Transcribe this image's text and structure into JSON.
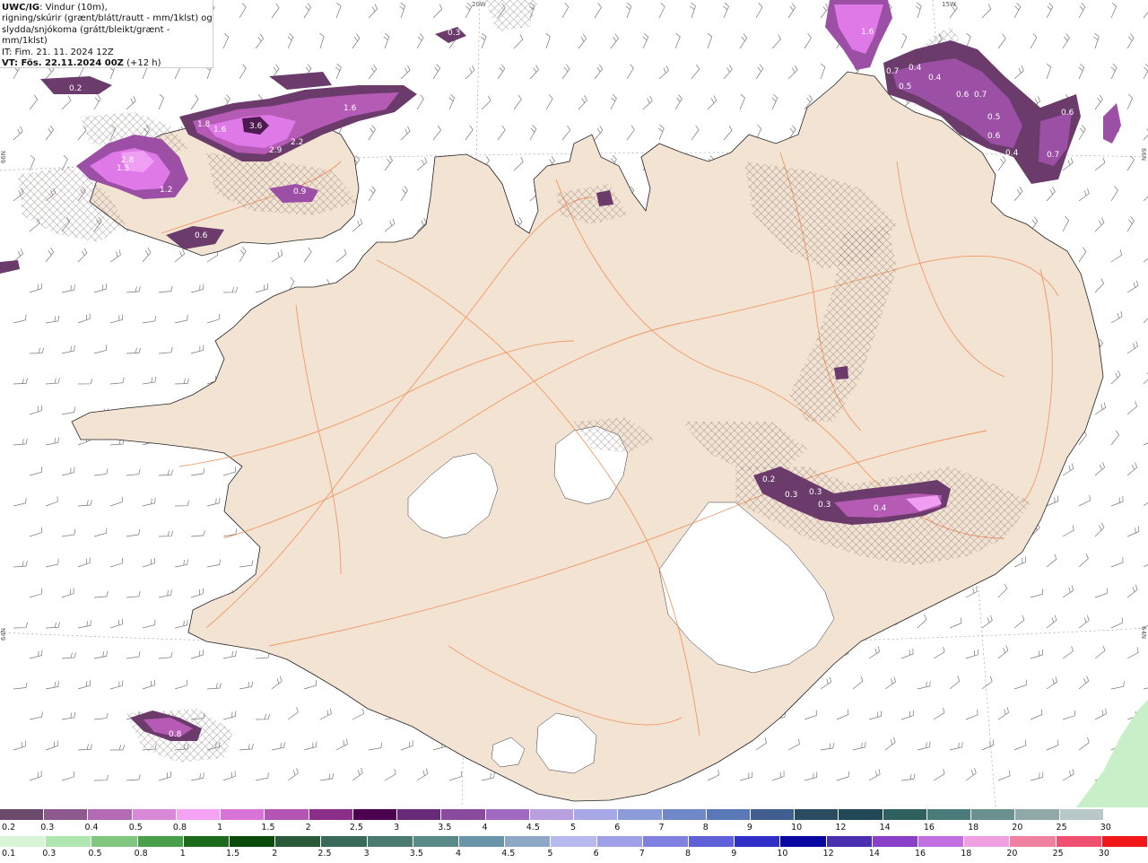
{
  "header": {
    "brand": "UWC/IG",
    "line1_rest": ": Vindur (10m),",
    "line2": "rigning/skúrir (grænt/blátt/rautt - mm/1klst) og",
    "line3": "slydda/snjókoma (grátt/bleikt/grænt - mm/1klst)",
    "line4": "IT: Fim. 21. 11. 2024 12Z",
    "line5_bold": "VT: Fös. 22.11.2024 00Z",
    "line5_rest": " (+12 h)"
  },
  "edge_labels": {
    "top_20w": "20W",
    "top_15w": "15W",
    "left_66n": "66N",
    "right_66n": "66N",
    "left_64n": "64N",
    "right_64n": "64N"
  },
  "colors": {
    "land": "#f3e3d3",
    "roads": "#f08a50",
    "hatch": "#7a6a6a",
    "snow_dark": "#6b3b6b",
    "snow_mid": "#9b4fa5",
    "snow_pink": "#e079e8",
    "snow_light": "#ef9ef3"
  },
  "precip_labels": [
    {
      "text": "0.2"
    },
    {
      "text": "0.3"
    },
    {
      "text": "1.6"
    },
    {
      "text": "1.6"
    },
    {
      "text": "1.8"
    },
    {
      "text": "3.6"
    },
    {
      "text": "1.6"
    },
    {
      "text": "2.9"
    },
    {
      "text": "2.2"
    },
    {
      "text": "2.8"
    },
    {
      "text": "1.5"
    },
    {
      "text": "1.2"
    },
    {
      "text": "0.9"
    },
    {
      "text": "0.6"
    },
    {
      "text": "0.7"
    },
    {
      "text": "0.4"
    },
    {
      "text": "0.5"
    },
    {
      "text": "0.4"
    },
    {
      "text": "0.6"
    },
    {
      "text": "0.7"
    },
    {
      "text": "0.5"
    },
    {
      "text": "0.6"
    },
    {
      "text": "0.4"
    },
    {
      "text": "0.7"
    },
    {
      "text": "0.6"
    },
    {
      "text": "0.2"
    },
    {
      "text": "0.3"
    },
    {
      "text": "0.3"
    },
    {
      "text": "0.3"
    },
    {
      "text": "0.4"
    },
    {
      "text": "0.8"
    }
  ],
  "legend_snow": {
    "values": [
      "0.2",
      "0.3",
      "0.4",
      "0.5",
      "0.8",
      "1",
      "1.5",
      "2",
      "2.5",
      "3",
      "3.5",
      "4",
      "4.5",
      "5",
      "6",
      "7",
      "8",
      "9",
      "10",
      "12",
      "14",
      "16",
      "18",
      "20",
      "25",
      "30"
    ],
    "colors": [
      "#6b4a6b",
      "#8e5a8e",
      "#b56ab5",
      "#d88ad8",
      "#f5a3f5",
      "#d873d8",
      "#b454b4",
      "#8a2e8a",
      "#4d0050",
      "#6a2a7a",
      "#8a4a9e",
      "#a06ac0",
      "#b8a0e0",
      "#a8a8e8",
      "#8c9cd8",
      "#7088c8",
      "#5878b8",
      "#405f90",
      "#2c4a60",
      "#224855",
      "#2e6060",
      "#4a7a7a",
      "#6a9090",
      "#90a8a8",
      "#b8c8c8",
      "#ffffff"
    ]
  },
  "legend_rain": {
    "values": [
      "0.1",
      "0.3",
      "0.5",
      "0.8",
      "1",
      "1.5",
      "2",
      "2.5",
      "3",
      "3.5",
      "4",
      "4.5",
      "5",
      "6",
      "7",
      "8",
      "9",
      "10",
      "12",
      "14",
      "16",
      "18",
      "20",
      "25",
      "30"
    ],
    "colors": [
      "#d8f5d8",
      "#b0e6b0",
      "#80c880",
      "#4aa04a",
      "#1c6a1c",
      "#0a4a0a",
      "#2a5a3a",
      "#3a6a5a",
      "#4a7a70",
      "#5a8a88",
      "#6a94a8",
      "#90a8c8",
      "#b8b8f0",
      "#a0a0e8",
      "#8080e0",
      "#6060d8",
      "#3030c8",
      "#0808a0",
      "#4a30b0",
      "#8a40c8",
      "#c070e0",
      "#f0a0e0",
      "#f080a0",
      "#f05070",
      "#f01818"
    ]
  }
}
